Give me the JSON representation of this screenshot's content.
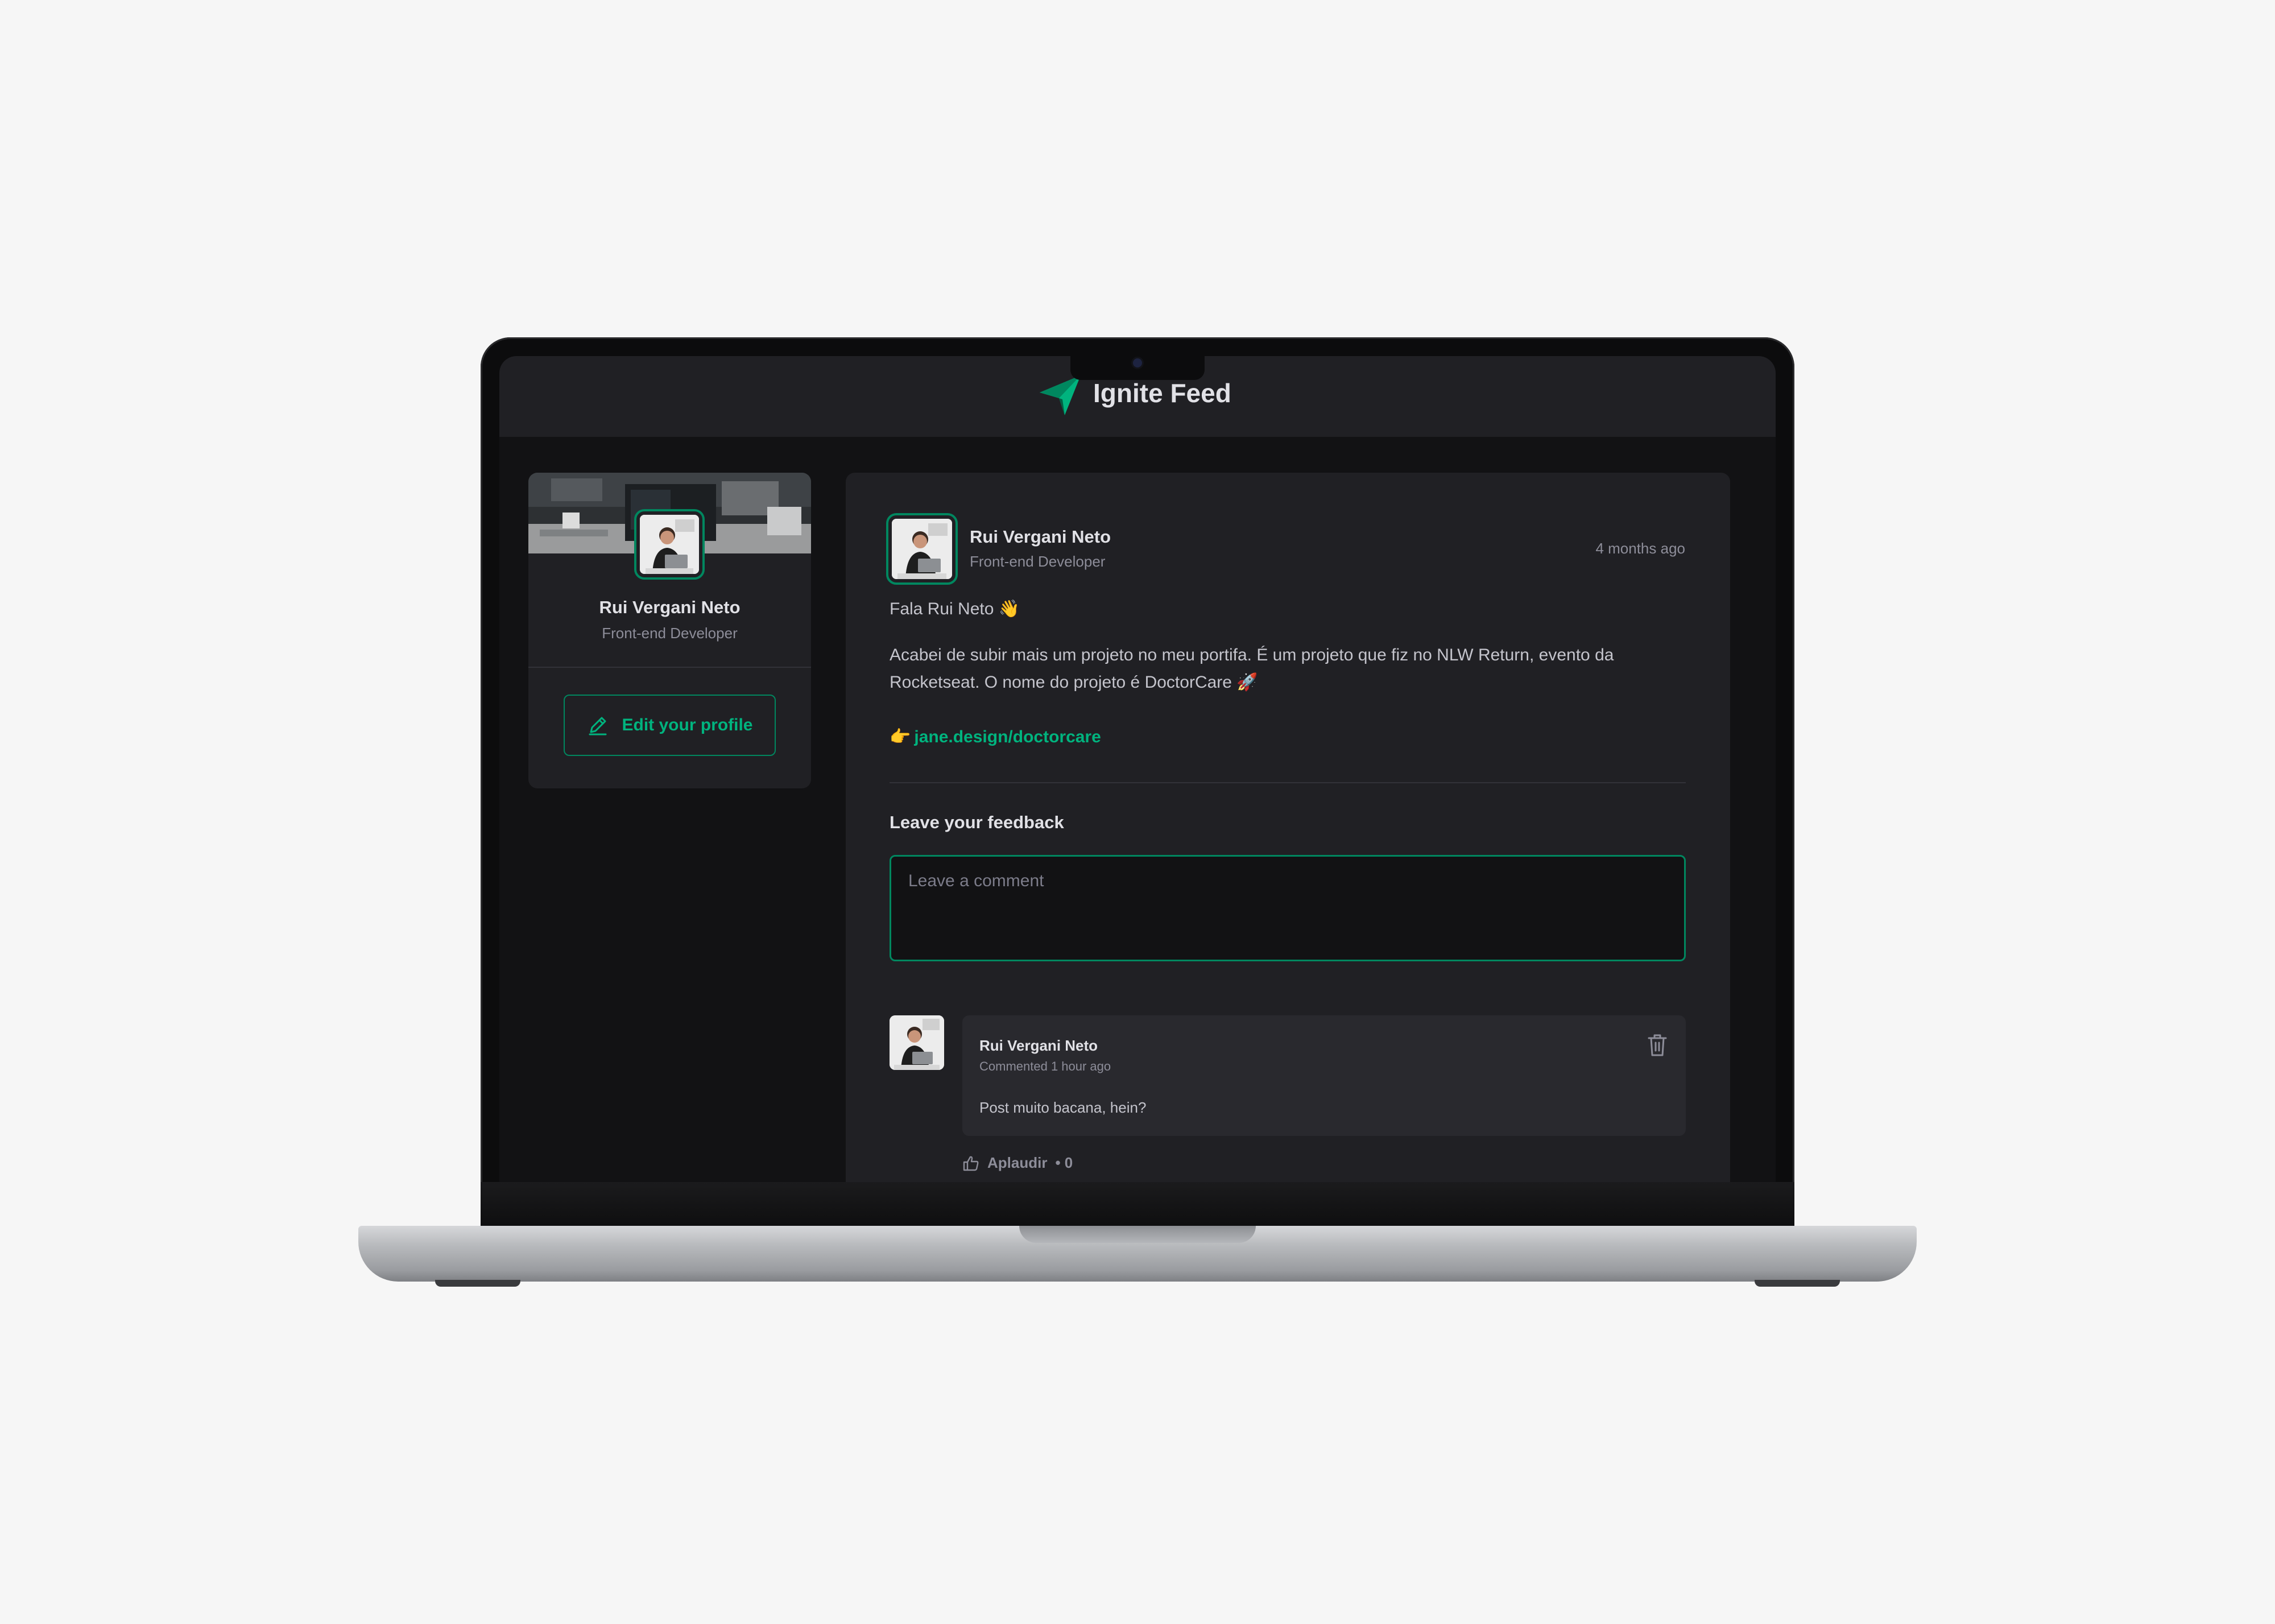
{
  "app": {
    "title": "Ignite Feed"
  },
  "profile": {
    "name": "Rui Vergani Neto",
    "role": "Front-end Developer",
    "edit_label": "Edit your profile"
  },
  "post": {
    "author": "Rui Vergani Neto",
    "role": "Front-end Developer",
    "time": "4 months ago",
    "greeting": "Fala Rui Neto 👋",
    "body": "Acabei de subir mais um projeto no meu portifa. É um projeto que fiz no NLW Return, evento da Rocketseat. O nome do projeto é DoctorCare 🚀",
    "link_emoji": "👉",
    "link_text": "jane.design/doctorcare"
  },
  "feedback": {
    "title": "Leave your feedback",
    "placeholder": "Leave a comment"
  },
  "comment": {
    "author": "Rui Vergani Neto",
    "time": "Commented 1 hour ago",
    "text": "Post muito bacana, hein?",
    "applaud_label": "Aplaudir",
    "applaud_count": "• 0"
  },
  "icons": {
    "logo": "paper-plane-logo-icon",
    "edit": "pencil-icon",
    "delete": "trash-icon",
    "applaud": "thumbs-up-icon"
  },
  "colors": {
    "accent": "#00875f",
    "accent_light": "#00b37e",
    "background": "#121214",
    "surface": "#202024",
    "comment_surface": "#29292e"
  }
}
